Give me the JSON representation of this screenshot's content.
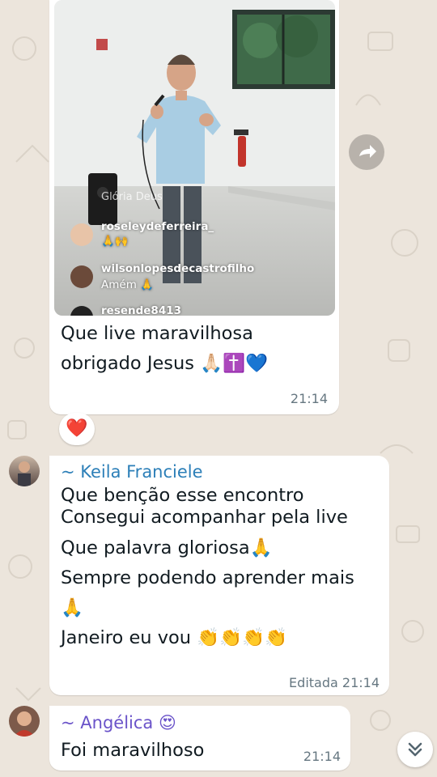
{
  "messages": [
    {
      "type": "video",
      "overlay": {
        "faded_text": "Glória Deus",
        "comments": [
          {
            "user": "roseleydeferreira_",
            "text": "🙏🙌"
          },
          {
            "user": "wilsonlopesdecastrofilho",
            "text": "Amém 🙏"
          },
          {
            "user": "resende8413",
            "text": ""
          }
        ]
      },
      "lines": [
        "Que live maravilhosa",
        "obrigado Jesus 🙏🏻✝️💙"
      ],
      "time": "21:14",
      "reaction": "❤️"
    },
    {
      "type": "text",
      "sender": "~ Keila Franciele",
      "sender_color": "#2c7fb8",
      "lines": [
        "Que benção esse encontro",
        "Consegui acompanhar pela live",
        "Que palavra gloriosa🙏",
        "Sempre podendo aprender mais",
        "🙏",
        "Janeiro eu vou 👏👏👏👏"
      ],
      "time": "Editada 21:14"
    },
    {
      "type": "text",
      "sender": "~ Angélica 😍",
      "sender_color": "#6a53c9",
      "lines": [
        "Foi maravilhoso"
      ],
      "time": "21:14"
    }
  ],
  "icons": {
    "forward": "forward-icon",
    "scroll_down": "double-chevron-down-icon"
  }
}
